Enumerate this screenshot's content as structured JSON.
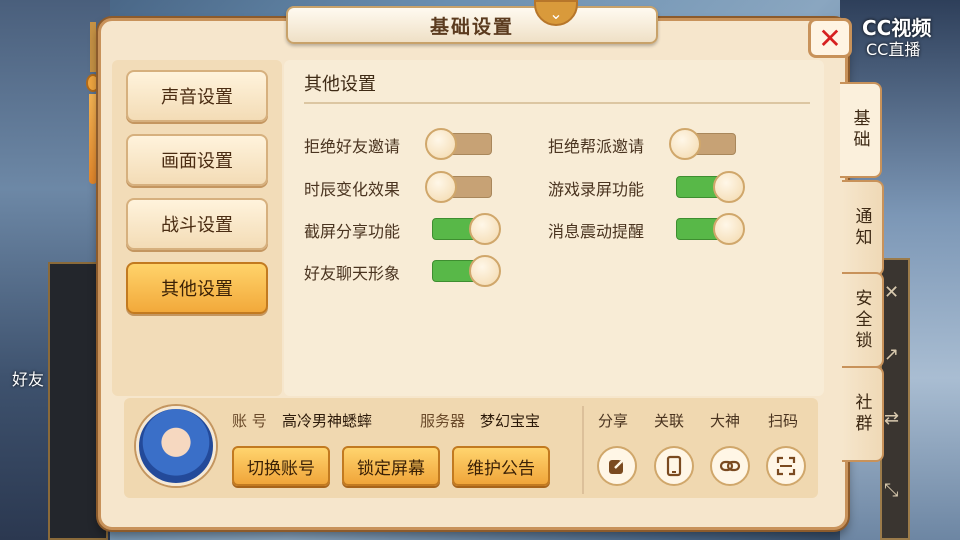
{
  "window": {
    "title": "基础设置"
  },
  "watermark": {
    "line1": "CC视频",
    "line2": "CC直播"
  },
  "background": {
    "friend_label": "好友"
  },
  "menu": {
    "items": [
      {
        "label": "声音设置",
        "active": false
      },
      {
        "label": "画面设置",
        "active": false
      },
      {
        "label": "战斗设置",
        "active": false
      },
      {
        "label": "其他设置",
        "active": true
      }
    ]
  },
  "section": {
    "title": "其他设置"
  },
  "settings": {
    "reject_friend_invite": {
      "label": "拒绝好友邀请",
      "on": false
    },
    "reject_guild_invite": {
      "label": "拒绝帮派邀请",
      "on": false
    },
    "time_change_effect": {
      "label": "时辰变化效果",
      "on": false
    },
    "game_recording": {
      "label": "游戏录屏功能",
      "on": true
    },
    "screenshot_share": {
      "label": "截屏分享功能",
      "on": true
    },
    "message_vibrate": {
      "label": "消息震动提醒",
      "on": true
    },
    "friend_chat_avatar": {
      "label": "好友聊天形象",
      "on": true
    }
  },
  "account": {
    "account_label": "账 号",
    "account_value": "高冷男神蟋蟀",
    "server_label": "服务器",
    "server_value": "梦幻宝宝",
    "switch_button": "切换账号",
    "lock_button": "锁定屏幕",
    "notice_button": "维护公告"
  },
  "links": {
    "share": "分享",
    "link": "关联",
    "master": "大神",
    "scan": "扫码"
  },
  "tabs": [
    {
      "label": "基础",
      "active": true
    },
    {
      "label": "通知",
      "active": false
    },
    {
      "label": "安全锁",
      "active": false
    },
    {
      "label": "社群",
      "active": false
    }
  ],
  "colors": {
    "panel": "#f6e6cc",
    "active_button": "#f2a93b",
    "toggle_on": "#58b848",
    "toggle_off": "#c7a275"
  }
}
